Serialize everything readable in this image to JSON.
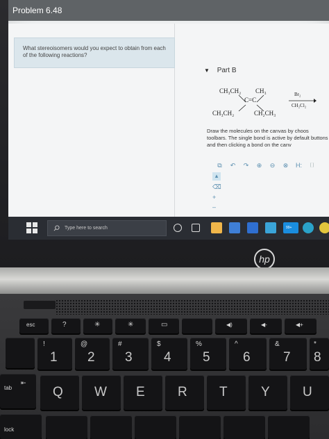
{
  "app": {
    "title": "Problem 6.48"
  },
  "question": {
    "text": "What stereoisomers would you expect to obtain from each of the following reactions?"
  },
  "part": {
    "label": "Part B"
  },
  "reaction": {
    "top_left": "CH₃CH₂",
    "top_right": "CH₃",
    "center": "C=C",
    "bottom_left": "CH₃CH₂",
    "bottom_right": "CH₂CH₃",
    "reagent_top": "Br₂",
    "reagent_bottom": "CH₂Cl₂"
  },
  "instructions": {
    "text": "Draw the molecules on the canvas by choos toolbars. The single bond is active by default buttons and then clicking a bond on the canv"
  },
  "toolbar": {
    "h_label": "H:",
    "info_label": "[ ]"
  },
  "taskbar": {
    "search_placeholder": "Type here to search",
    "badge": "99+"
  },
  "keyboard": {
    "esc": "esc",
    "tab": "tab",
    "lock": "lock",
    "hp": "hp",
    "row_numbers": [
      {
        "top": "!",
        "main": "1"
      },
      {
        "top": "@",
        "main": "2"
      },
      {
        "top": "#",
        "main": "3"
      },
      {
        "top": "$",
        "main": "4"
      },
      {
        "top": "%",
        "main": "5"
      },
      {
        "top": "^",
        "main": "6"
      },
      {
        "top": "&",
        "main": "7"
      },
      {
        "top": "*",
        "main": "8"
      }
    ],
    "row_letters": [
      "Q",
      "W",
      "E",
      "R",
      "T",
      "Y",
      "U"
    ],
    "fn_keys": [
      "?",
      "✳",
      "✳",
      "▭",
      "",
      "◀)",
      "◀-",
      "◀+"
    ]
  },
  "colors": {
    "titlebar": "#5f6366",
    "question_bg": "#dbe6ec",
    "taskbar": "#2a2d33",
    "key": "#141416"
  }
}
